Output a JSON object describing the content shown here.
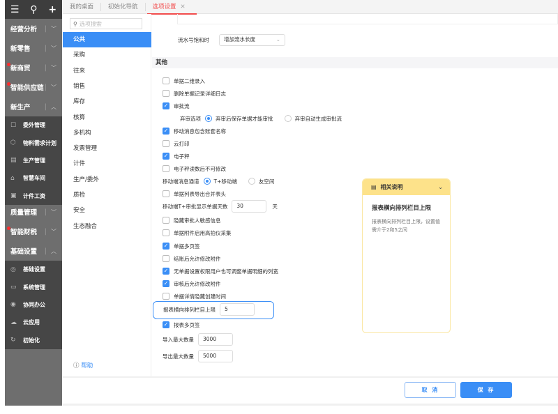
{
  "sidebar": {
    "top_icons": [
      "menu-icon",
      "search-icon",
      "plus-icon"
    ],
    "groups": [
      {
        "label": "经营分析",
        "expanded": false,
        "dot": false
      },
      {
        "label": "新零售",
        "expanded": false,
        "dot": false
      },
      {
        "label": "新商贸",
        "expanded": false,
        "dot": true
      },
      {
        "label": "智能供应链",
        "expanded": false,
        "dot": true
      },
      {
        "label": "新生产",
        "expanded": true,
        "dot": false
      },
      {
        "label": "质量管理",
        "expanded": false,
        "dot": false
      },
      {
        "label": "智能财税",
        "expanded": false,
        "dot": true
      },
      {
        "label": "基础设置",
        "expanded": true,
        "dot": false
      }
    ],
    "production_items": [
      {
        "label": "委外管理",
        "icon": "outsource-icon"
      },
      {
        "label": "物料需求计划",
        "icon": "cube-icon"
      },
      {
        "label": "生产管理",
        "icon": "production-icon"
      },
      {
        "label": "智慧车间",
        "icon": "workshop-icon"
      },
      {
        "label": "计件工资",
        "icon": "wage-icon"
      }
    ],
    "basic_items": [
      {
        "label": "基础设置",
        "icon": "settings-icon"
      },
      {
        "label": "系统管理",
        "icon": "monitor-icon"
      },
      {
        "label": "协同办公",
        "icon": "collab-icon"
      },
      {
        "label": "云应用",
        "icon": "cloud-icon"
      },
      {
        "label": "初始化",
        "icon": "init-icon"
      }
    ]
  },
  "tabs": [
    {
      "label": "我的桌面"
    },
    {
      "label": "初始化导航"
    },
    {
      "label": "选项设置",
      "active": true
    }
  ],
  "categories": {
    "search_placeholder": "选项搜索",
    "items": [
      "公共",
      "采购",
      "往来",
      "销售",
      "库存",
      "核算",
      "多机构",
      "发票管理",
      "计件",
      "生产/委外",
      "质检",
      "安全",
      "生态融合"
    ],
    "active": "公共",
    "help": "帮助"
  },
  "main": {
    "serial_label": "流水号饱和时",
    "serial_value": "增加流水长度",
    "section": "其他",
    "options": [
      {
        "type": "checkbox",
        "label": "单据二维录入",
        "checked": false
      },
      {
        "type": "checkbox",
        "label": "删除单据记录详细日志",
        "checked": false
      },
      {
        "type": "checkbox",
        "label": "审批流",
        "checked": true
      },
      {
        "type": "radio",
        "label": "弃审选项",
        "choices": [
          "弃审后保存单据才能审批",
          "弃审自动生成审批流"
        ],
        "selected": 0
      },
      {
        "type": "checkbox",
        "label": "移动消息包含账套名称",
        "checked": true
      },
      {
        "type": "checkbox",
        "label": "云打印",
        "checked": false
      },
      {
        "type": "checkbox",
        "label": "电子秤",
        "checked": true
      },
      {
        "type": "checkbox",
        "label": "电子秤读数后不可修改",
        "checked": false
      },
      {
        "type": "radio",
        "label": "移动端消息通道",
        "choices": [
          "T+移动端",
          "友空间"
        ],
        "selected": 0
      },
      {
        "type": "checkbox",
        "label": "单据列表导出合并表头",
        "checked": false
      },
      {
        "type": "input",
        "label": "移动端T+审批显示单据天数",
        "value": "30",
        "unit": "天"
      },
      {
        "type": "checkbox",
        "label": "隐藏审批人敏感信息",
        "checked": false
      },
      {
        "type": "checkbox",
        "label": "单据附件启用高拍仪采集",
        "checked": false
      },
      {
        "type": "checkbox",
        "label": "单据多页签",
        "checked": true
      },
      {
        "type": "checkbox",
        "label": "结账后允许修改附件",
        "checked": false
      },
      {
        "type": "checkbox",
        "label": "无单据设置权限用户也可调整单据明细的列宽",
        "checked": true
      },
      {
        "type": "checkbox",
        "label": "审核后允许修改附件",
        "checked": true
      },
      {
        "type": "checkbox",
        "label": "单据详情隐藏创建时间",
        "checked": false
      },
      {
        "type": "input",
        "label": "报表横向排列栏目上限",
        "value": "5",
        "highlighted": true
      },
      {
        "type": "checkbox",
        "label": "报表多页签",
        "checked": true
      },
      {
        "type": "input",
        "label": "导入最大数量",
        "value": "3000"
      },
      {
        "type": "input",
        "label": "导出最大数量",
        "value": "5000"
      }
    ]
  },
  "info": {
    "header": "相关说明",
    "title": "报表横向排列栏目上限",
    "body": "报表横向排列栏目上限，设置值需介于2和5之间"
  },
  "footer": {
    "cancel": "取 消",
    "save": "保 存"
  },
  "colors": {
    "accent": "#3a8ef6",
    "tab_active": "#f24c4c",
    "info_header": "#fde28a"
  }
}
